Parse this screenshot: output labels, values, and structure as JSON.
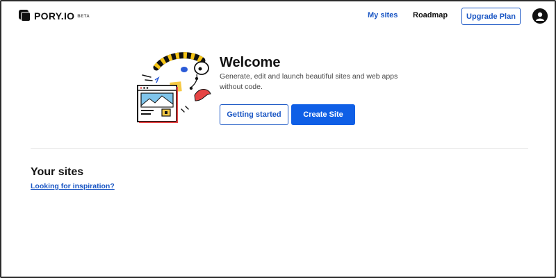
{
  "header": {
    "logo_text": "PORY.IO",
    "logo_badge": "BETA",
    "nav": [
      {
        "label": "My sites",
        "active": true
      },
      {
        "label": "Roadmap",
        "active": false
      }
    ],
    "upgrade_label": "Upgrade Plan",
    "avatar_icon": "user-avatar-icon"
  },
  "welcome": {
    "title": "Welcome",
    "description": "Generate, edit and launch beautiful sites and web apps without code.",
    "buttons": {
      "getting_started": "Getting started",
      "create_site": "Create Site"
    },
    "illustration_icon": "browser-doodle-illustration"
  },
  "sites": {
    "title": "Your sites",
    "inspiration_link": "Looking for inspiration?"
  },
  "colors": {
    "accent": "#1a56c4",
    "primary_button": "#0f5fe6",
    "text": "#111111",
    "muted": "#444444"
  }
}
